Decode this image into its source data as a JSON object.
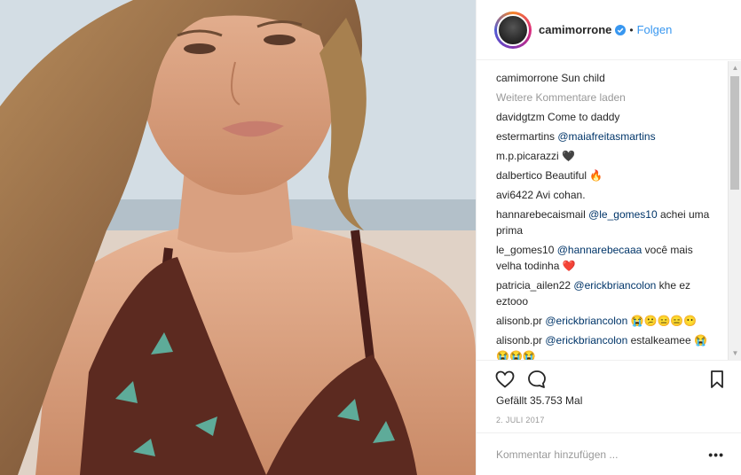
{
  "post": {
    "username": "camimorrone",
    "separator": "•",
    "follow_label": "Folgen"
  },
  "comments": [
    {
      "user": "camimorrone",
      "mention": "",
      "text": "Sun child"
    },
    {
      "user": "davidgtzm",
      "mention": "",
      "text": "Come to daddy"
    },
    {
      "user": "estermartins",
      "mention": "@maiafreitasmartins",
      "text": ""
    },
    {
      "user": "m.p.picarazzi",
      "mention": "",
      "text": "🖤"
    },
    {
      "user": "dalbertico",
      "mention": "",
      "text": "Beautiful 🔥"
    },
    {
      "user": "avi6422",
      "mention": "",
      "text": "Avi cohan."
    },
    {
      "user": "hannarebecaismail",
      "mention": "@le_gomes10",
      "text": "achei uma prima"
    },
    {
      "user": "le_gomes10",
      "mention": "@hannarebecaaa",
      "text": "você mais velha todinha ❤️"
    },
    {
      "user": "patricia_ailen22",
      "mention": "@erickbriancolon",
      "text": "khe ez eztooo"
    },
    {
      "user": "alisonb.pr",
      "mention": "@erickbriancolon",
      "text": "😭😕😑😑😶"
    },
    {
      "user": "alisonb.pr",
      "mention": "@erickbriancolon",
      "text": "estalkeamee 😭😭😭😭"
    }
  ],
  "load_more_label": "Weitere Kommentare laden",
  "likes_label": "Gefällt 35.753 Mal",
  "date_label": "2. JULI 2017",
  "add_comment_placeholder": "Kommentar hinzufügen ...",
  "more_options_label": "•••",
  "colors": {
    "link": "#3897f0",
    "mention": "#003569",
    "muted": "#999999",
    "verified": "#3897f0"
  }
}
